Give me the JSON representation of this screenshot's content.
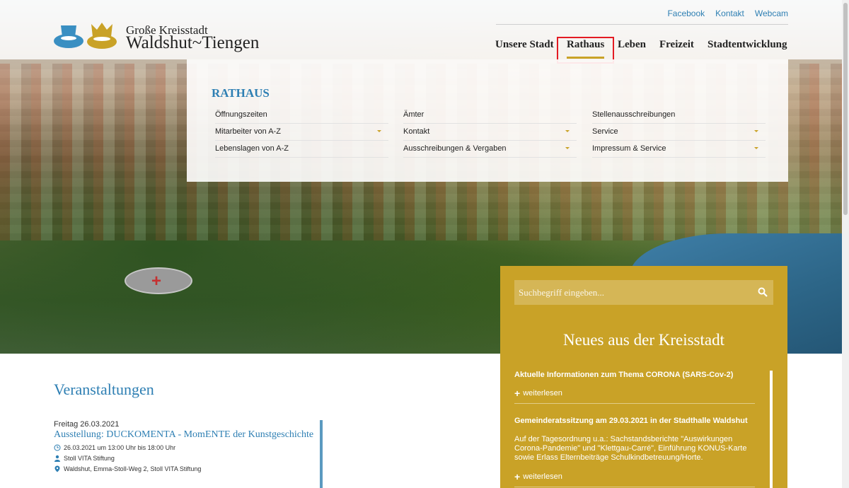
{
  "header": {
    "logo": {
      "line1": "Große Kreisstadt",
      "line2": "Waldshut~Tiengen",
      "hat_color": "#3a8fc2",
      "crown_color": "#c9a227"
    },
    "top_links": [
      "Facebook",
      "Kontakt",
      "Webcam"
    ],
    "main_nav": [
      "Unsere Stadt",
      "Rathaus",
      "Leben",
      "Freizeit",
      "Stadtentwicklung"
    ],
    "active_nav": "Rathaus"
  },
  "mega_menu": {
    "title": "RATHAUS",
    "columns": [
      [
        {
          "label": "Öffnungszeiten",
          "has_submenu": false
        },
        {
          "label": "Mitarbeiter von A-Z",
          "has_submenu": true
        },
        {
          "label": "Lebenslagen von A-Z",
          "has_submenu": false
        }
      ],
      [
        {
          "label": "Ämter",
          "has_submenu": false
        },
        {
          "label": "Kontakt",
          "has_submenu": true
        },
        {
          "label": "Ausschreibungen & Vergaben",
          "has_submenu": true
        }
      ],
      [
        {
          "label": "Stellenausschreibungen",
          "has_submenu": false
        },
        {
          "label": "Service",
          "has_submenu": true
        },
        {
          "label": "Impressum & Service",
          "has_submenu": true
        }
      ]
    ]
  },
  "search": {
    "placeholder": "Suchbegriff eingeben..."
  },
  "news": {
    "heading": "Neues aus der Kreisstadt",
    "items": [
      {
        "title": "Aktuelle Informationen zum Thema CORONA (SARS-Cov-2)",
        "text": "",
        "more": "weiterlesen"
      },
      {
        "title": "Gemeinderatssitzung am 29.03.2021 in der Stadthalle Waldshut",
        "text": "Auf der Tagesordnung u.a.: Sachstandsberichte \"Auswirkungen Corona-Pandemie\" und \"Klettgau-Carré\", Einführung KONUS-Karte sowie Erlass Elternbeiträge Schulkindbetreuung/Horte.",
        "more": "weiterlesen"
      }
    ],
    "accent_color": "#c9a227"
  },
  "events": {
    "heading": "Veranstaltungen",
    "items": [
      {
        "date": "Freitag 26.03.2021",
        "title": "Ausstellung: DUCKOMENTA - MomENTE der Kunstgeschichte",
        "time": "26.03.2021 um 13:00 Uhr bis 18:00 Uhr",
        "organizer": "Stoll VITA Stiftung",
        "location": "Waldshut, Emma-Stoll-Weg 2, Stoll VITA Stiftung"
      }
    ]
  },
  "colors": {
    "link_blue": "#2e7fb3",
    "gold": "#c9a227",
    "highlight_red": "#e31b23"
  }
}
